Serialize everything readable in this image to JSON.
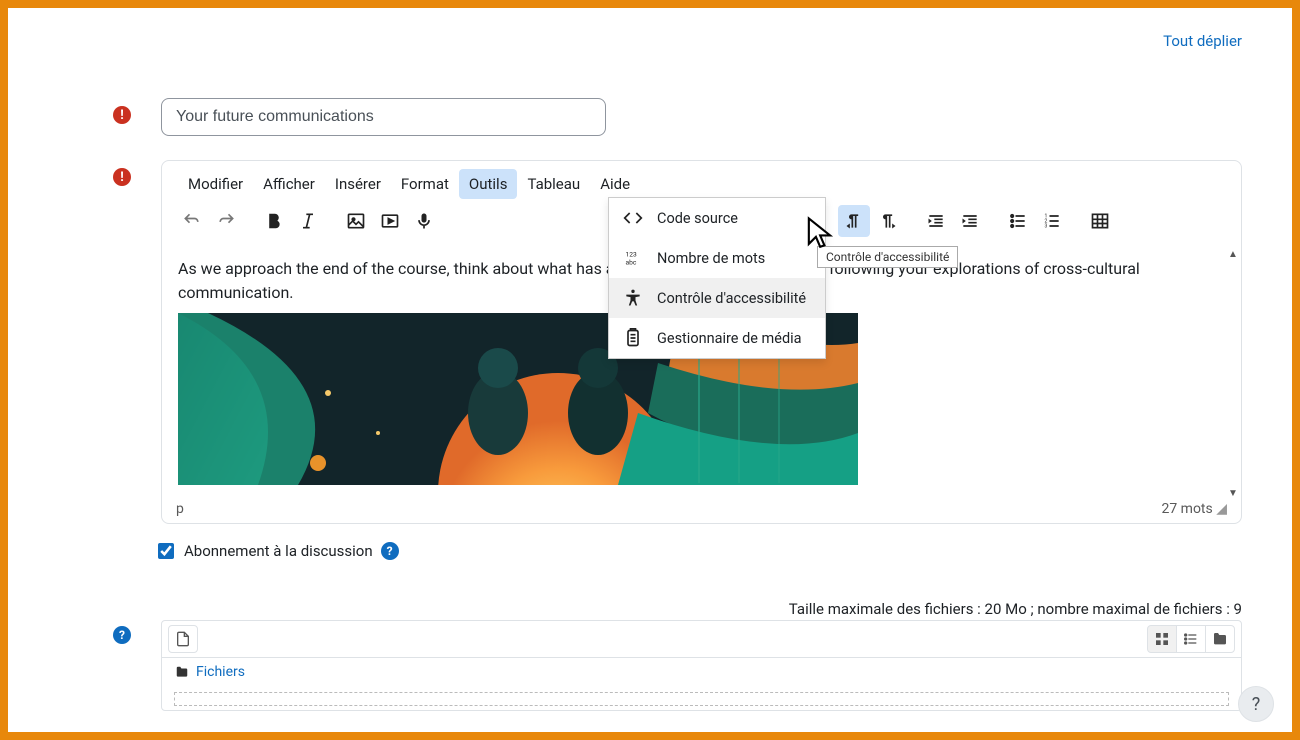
{
  "top": {
    "expand_all": "Tout déplier"
  },
  "title_field": {
    "value": "Your future communications"
  },
  "editor": {
    "menubar": [
      "Modifier",
      "Afficher",
      "Insérer",
      "Format",
      "Outils",
      "Tableau",
      "Aide"
    ],
    "active_menu_index": 4,
    "dropdown": {
      "items": [
        {
          "label": "Code source",
          "icon": "code-icon"
        },
        {
          "label": "Nombre de mots",
          "icon": "wordcount-icon"
        },
        {
          "label": "Contrôle d'accessibilité",
          "icon": "accessibility-icon"
        },
        {
          "label": "Gestionnaire de média",
          "icon": "media-manager-icon"
        }
      ]
    },
    "tooltip": "Contrôle d'accessibilité",
    "content_text": "As we approach the end of the course, think about what has already changed or will change following your explorations of cross-cultural communication.",
    "statusbar": {
      "path": "p",
      "words": "27 mots"
    }
  },
  "subscribe": {
    "label": "Abonnement à la discussion",
    "checked": true
  },
  "files": {
    "limit_text": "Taille maximale des fichiers : 20 Mo ; nombre maximal de fichiers : 9",
    "path_label": "Fichiers"
  },
  "fab": {
    "label": "?"
  }
}
